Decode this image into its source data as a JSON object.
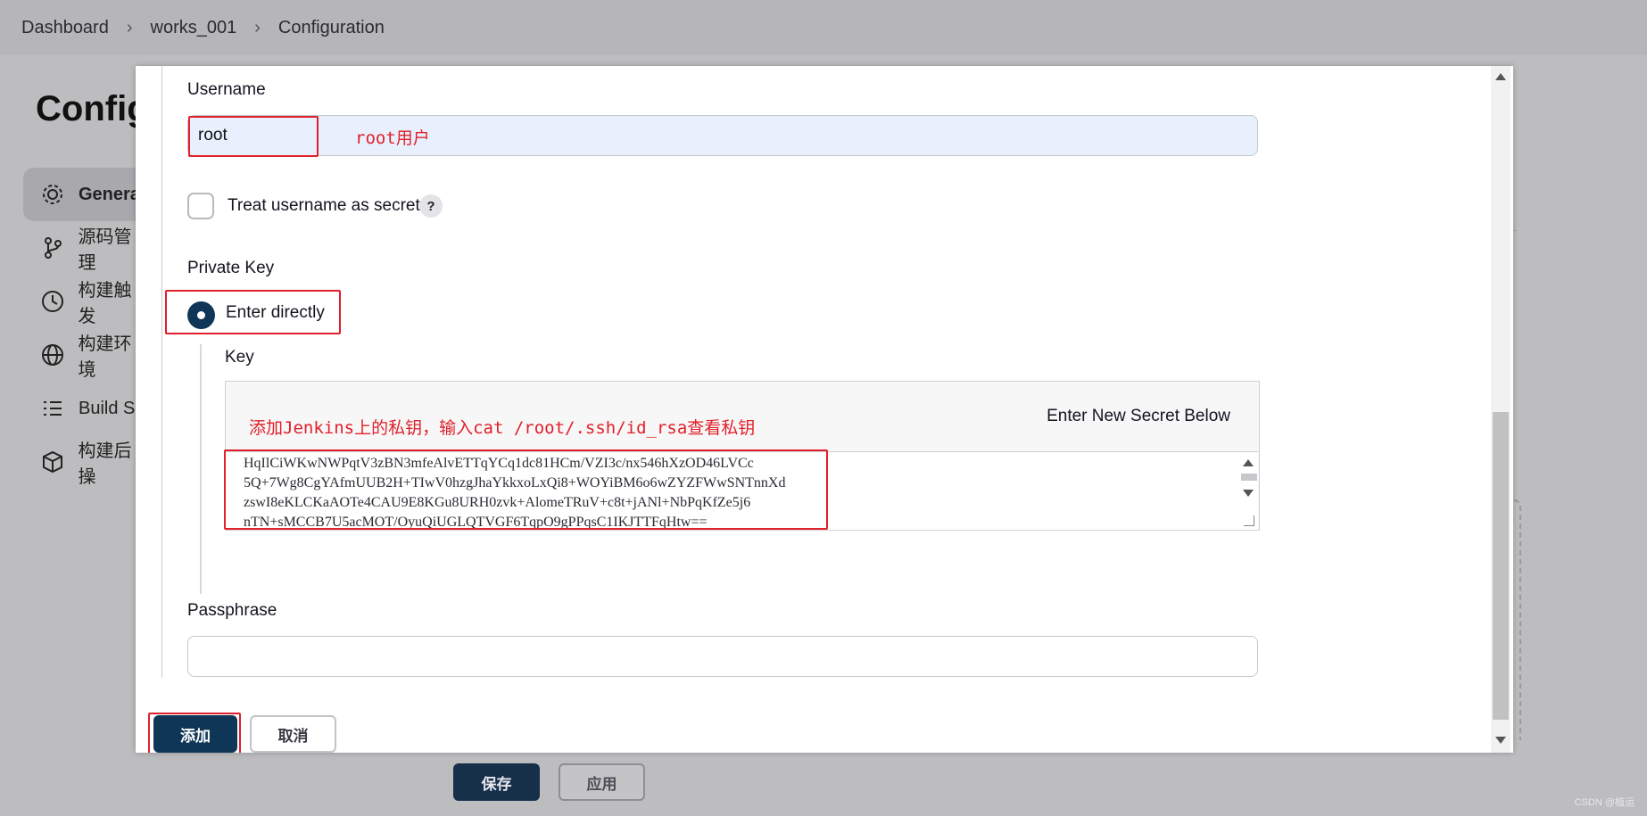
{
  "breadcrumb": [
    "Dashboard",
    "works_001",
    "Configuration"
  ],
  "background": {
    "page_title": "Config",
    "sidebar": [
      {
        "label": "Genera",
        "icon": "gear-icon",
        "active": true
      },
      {
        "label": "源码管理",
        "icon": "branch-icon"
      },
      {
        "label": "构建触发",
        "icon": "clock-icon"
      },
      {
        "label": "构建环境",
        "icon": "globe-icon"
      },
      {
        "label": "Build S",
        "icon": "list-icon"
      },
      {
        "label": "构建后操",
        "icon": "package-icon"
      }
    ],
    "save_label": "保存",
    "apply_label": "应用"
  },
  "modal": {
    "username_label": "Username",
    "username_value": "root",
    "username_annotation": "root用户",
    "treat_secret_label": "Treat username as secret",
    "help_label": "?",
    "private_key_label": "Private Key",
    "enter_directly_label": "Enter directly",
    "key_label": "Key",
    "secret_note": "Enter New Secret Below",
    "key_annotation": "添加Jenkins上的私钥，输入cat /root/.ssh/id_rsa查看私钥",
    "key_lines": [
      "HqIlCiWKwNWPqtV3zBN3mfeAlvETTqYCq1dc81HCm/VZI3c/nx546hXzOD46LVCc",
      "5Q+7Wg8CgYAfmUUB2H+TIwV0hzgJhaYkkxoLxQi8+WOYiBM6o6wZYZFWwSNTnnXd",
      "zswI8eKLCKaAOTe4CAU9E8KGu8URH0zvk+AlomeTRuV+c8t+jANl+NbPqKfZe5j6",
      "nTN+sMCCB7U5acMOT/OyuQiUGLQTVGF6TqpO9gPPqsC1IKJTTFqHtw=="
    ],
    "passphrase_label": "Passphrase",
    "add_label": "添加",
    "cancel_label": "取消"
  },
  "watermark": "CSDN @植运",
  "colors": {
    "primary": "#0f3657",
    "annotation_red": "#e0202a",
    "overlay": "#bdbdbf"
  }
}
